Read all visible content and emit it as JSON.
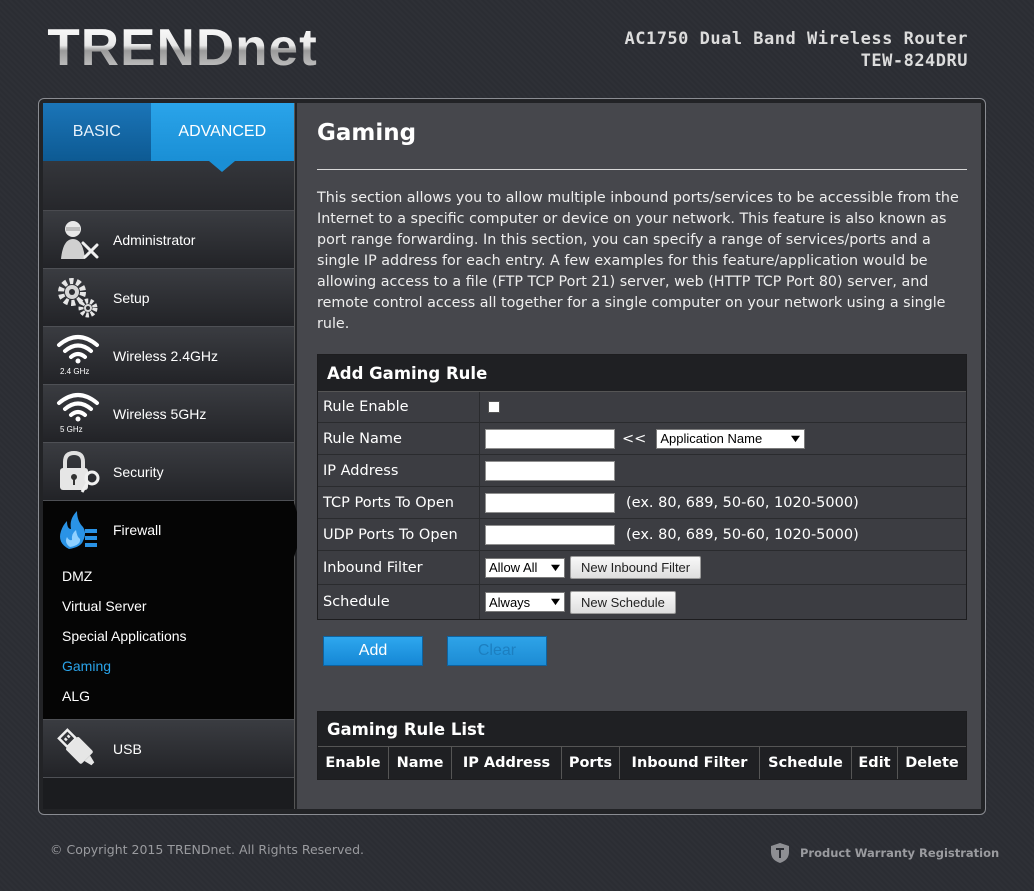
{
  "header": {
    "logo_text": "TRENDnet",
    "product_line1": "AC1750 Dual Band Wireless Router",
    "product_line2": "TEW-824DRU"
  },
  "tabs": [
    {
      "label": "BASIC"
    },
    {
      "label": "ADVANCED",
      "active": true
    }
  ],
  "sidebar": {
    "items": [
      {
        "label": "Administrator",
        "icon": "administrator-icon"
      },
      {
        "label": "Setup",
        "icon": "gears-icon"
      },
      {
        "label": "Wireless 2.4GHz",
        "icon": "wifi-icon",
        "badge": "2.4 GHz"
      },
      {
        "label": "Wireless 5GHz",
        "icon": "wifi-icon",
        "badge": "5 GHz"
      },
      {
        "label": "Security",
        "icon": "lock-key-icon"
      },
      {
        "label": "Firewall",
        "icon": "firewall-icon",
        "active": true
      },
      {
        "label": "USB",
        "icon": "usb-icon"
      }
    ],
    "firewall_sub": [
      {
        "label": "DMZ"
      },
      {
        "label": "Virtual Server"
      },
      {
        "label": "Special Applications"
      },
      {
        "label": "Gaming",
        "current": true
      },
      {
        "label": "ALG"
      }
    ]
  },
  "main": {
    "title": "Gaming",
    "description": "This section allows you to allow multiple inbound ports/services to be accessible from the Internet to a specific computer or device on your network. This feature is also known as port range forwarding. In this section, you can specify a range of services/ports and a single IP address for each entry. A few examples for this feature/application would be allowing access to a file (FTP TCP Port 21) server, web (HTTP TCP Port 80) server, and remote control access all together for a single computer on your network using a single rule."
  },
  "form": {
    "heading": "Add Gaming Rule",
    "rule_enable_label": "Rule Enable",
    "rule_enable_checked": false,
    "rule_name_label": "Rule Name",
    "rule_name_value": "",
    "arrow_text": "<<",
    "app_name_selected": "Application Name",
    "ip_label": "IP Address",
    "ip_value": "",
    "tcp_label": "TCP Ports To Open",
    "tcp_value": "",
    "tcp_hint": "(ex. 80, 689, 50-60, 1020-5000)",
    "udp_label": "UDP Ports To Open",
    "udp_value": "",
    "udp_hint": "(ex. 80, 689, 50-60, 1020-5000)",
    "inbound_label": "Inbound Filter",
    "inbound_selected": "Allow All",
    "new_inbound_button": "New Inbound Filter",
    "schedule_label": "Schedule",
    "schedule_selected": "Always",
    "new_schedule_button": "New Schedule",
    "add_button": "Add",
    "clear_button": "Clear"
  },
  "rule_list": {
    "heading": "Gaming Rule List",
    "columns": [
      "Enable",
      "Name",
      "IP Address",
      "Ports",
      "Inbound Filter",
      "Schedule",
      "Edit",
      "Delete"
    ],
    "rows": []
  },
  "footer": {
    "copyright": "© Copyright 2015 TRENDnet. All Rights Reserved.",
    "warranty_link": "Product Warranty Registration"
  },
  "colors": {
    "accent_blue": "#1a8fd5",
    "current_link": "#2aa4ea",
    "content_bg": "#46474c"
  }
}
